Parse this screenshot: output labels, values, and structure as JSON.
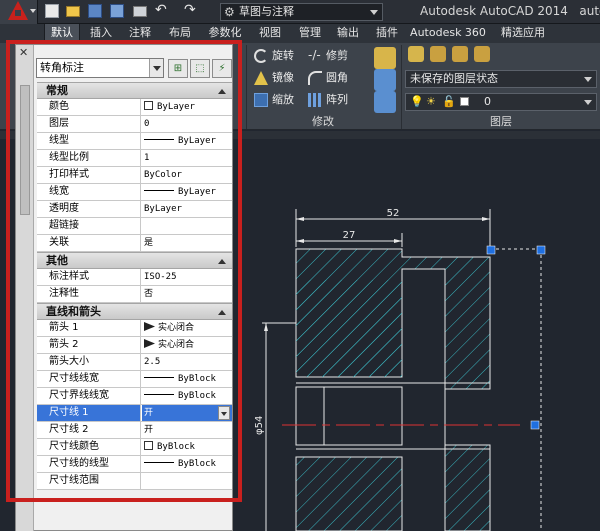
{
  "titlebar": {
    "workspace": "草图与注释",
    "app_title": "Autodesk AutoCAD 2014",
    "file_title": "autocad"
  },
  "tabs": [
    "默认",
    "插入",
    "注释",
    "布局",
    "参数化",
    "视图",
    "管理",
    "输出",
    "插件",
    "Autodesk 360",
    "精选应用"
  ],
  "modify_panel": {
    "label": "修改",
    "row1": [
      "旋转",
      "修剪"
    ],
    "row2": [
      "镜像",
      "圆角"
    ],
    "row3": [
      "缩放",
      "阵列"
    ]
  },
  "layer_panel": {
    "label": "图层",
    "state": "未保存的图层状态",
    "current_layer": "0"
  },
  "palette": {
    "selector": "转角标注",
    "sections": [
      {
        "title": "常规",
        "rows": [
          {
            "k": "颜色",
            "v": "ByLayer",
            "t": "color"
          },
          {
            "k": "图层",
            "v": "0"
          },
          {
            "k": "线型",
            "v": "ByLayer",
            "t": "line"
          },
          {
            "k": "线型比例",
            "v": "1"
          },
          {
            "k": "打印样式",
            "v": "ByColor"
          },
          {
            "k": "线宽",
            "v": "ByLayer",
            "t": "line"
          },
          {
            "k": "透明度",
            "v": "ByLayer"
          },
          {
            "k": "超链接",
            "v": ""
          },
          {
            "k": "关联",
            "v": "是"
          }
        ]
      },
      {
        "title": "其他",
        "rows": [
          {
            "k": "标注样式",
            "v": "ISO-25"
          },
          {
            "k": "注释性",
            "v": "否"
          }
        ]
      },
      {
        "title": "直线和箭头",
        "rows": [
          {
            "k": "箭头 1",
            "v": "实心闭合",
            "t": "arrow"
          },
          {
            "k": "箭头 2",
            "v": "实心闭合",
            "t": "arrow"
          },
          {
            "k": "箭头大小",
            "v": "2.5"
          },
          {
            "k": "尺寸线线宽",
            "v": "ByBlock",
            "t": "line"
          },
          {
            "k": "尺寸界线线宽",
            "v": "ByBlock",
            "t": "line"
          },
          {
            "k": "尺寸线 1",
            "v": "开",
            "t": "sel"
          },
          {
            "k": "尺寸线 2",
            "v": "开"
          },
          {
            "k": "尺寸线颜色",
            "v": "ByBlock",
            "t": "color"
          },
          {
            "k": "尺寸线的线型",
            "v": "ByBlock",
            "t": "line"
          },
          {
            "k": "尺寸线范围",
            "v": ""
          }
        ]
      }
    ]
  },
  "drawing": {
    "dim_overall": "52",
    "dim_step": "27",
    "dim_diameter": "φ54"
  },
  "colors": {
    "highlight_box": "#c9201e",
    "selection": "#3874d8",
    "grip": "#1f6fe0",
    "hatch": "#3ab7c2"
  }
}
